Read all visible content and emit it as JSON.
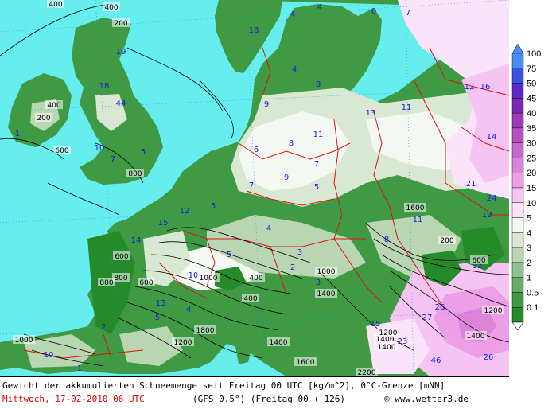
{
  "caption": {
    "description": "Gewicht der akkumulierten Schneemenge seit Freitag 00 UTC [kg/m^2], 0°C-Grenze [mNN]",
    "valid_time": "Mittwoch, 17-02-2010  06 UTC",
    "model_info": "(GFS 0.5°)  (Freitag 00 + 126)",
    "credit": "© www.wetter3.de"
  },
  "legend": {
    "levels": [
      "100",
      "75",
      "50",
      "45",
      "40",
      "35",
      "30",
      "25",
      "20",
      "15",
      "10",
      "5",
      "4",
      "3",
      "2",
      "1",
      "0.5",
      "0.1"
    ],
    "colors": [
      "#4a8cf0",
      "#3c50e0",
      "#5a28c8",
      "#7a28b4",
      "#9c3ab8",
      "#b450c0",
      "#c868cc",
      "#dc84d8",
      "#ec9ee6",
      "#f6c4f2",
      "#fbe4fa",
      "#f4f8f2",
      "#d8e8d2",
      "#b8d6b2",
      "#90c290",
      "#68ac6a",
      "#3c9a42",
      "#248a2a"
    ]
  },
  "map": {
    "sea_color": "#66eeee",
    "snow_labels": [
      {
        "text": "18"
      },
      {
        "text": "4"
      },
      {
        "text": "4"
      },
      {
        "text": "0"
      },
      {
        "text": "7"
      },
      {
        "text": "19"
      },
      {
        "text": "18"
      },
      {
        "text": "9"
      },
      {
        "text": "4"
      },
      {
        "text": "8"
      },
      {
        "text": "12"
      },
      {
        "text": "16"
      },
      {
        "text": "44"
      },
      {
        "text": "13"
      },
      {
        "text": "11"
      },
      {
        "text": "14"
      },
      {
        "text": "1"
      },
      {
        "text": "10"
      },
      {
        "text": "5"
      },
      {
        "text": "7"
      },
      {
        "text": "6"
      },
      {
        "text": "8"
      },
      {
        "text": "11"
      },
      {
        "text": "7"
      },
      {
        "text": "9"
      },
      {
        "text": "7"
      },
      {
        "text": "5"
      },
      {
        "text": "21"
      },
      {
        "text": "24"
      },
      {
        "text": "15"
      },
      {
        "text": "12"
      },
      {
        "text": "5"
      },
      {
        "text": "4"
      },
      {
        "text": "11"
      },
      {
        "text": "19"
      },
      {
        "text": "14"
      },
      {
        "text": "5"
      },
      {
        "text": "3"
      },
      {
        "text": "8"
      },
      {
        "text": "32"
      },
      {
        "text": "10"
      },
      {
        "text": "13"
      },
      {
        "text": "5"
      },
      {
        "text": "4"
      },
      {
        "text": "15"
      },
      {
        "text": "26"
      },
      {
        "text": "27"
      },
      {
        "text": "2"
      },
      {
        "text": "46"
      },
      {
        "text": "26"
      },
      {
        "text": "23"
      },
      {
        "text": "10"
      },
      {
        "text": "3"
      },
      {
        "text": "2"
      },
      {
        "text": "1"
      }
    ],
    "contour_labels": [
      {
        "text": "400"
      },
      {
        "text": "400"
      },
      {
        "text": "200"
      },
      {
        "text": "400"
      },
      {
        "text": "200"
      },
      {
        "text": "600"
      },
      {
        "text": "600"
      },
      {
        "text": "800"
      },
      {
        "text": "800"
      },
      {
        "text": "600"
      },
      {
        "text": "1000"
      },
      {
        "text": "1800"
      },
      {
        "text": "1200"
      },
      {
        "text": "1400"
      },
      {
        "text": "400"
      },
      {
        "text": "1000"
      },
      {
        "text": "1400"
      },
      {
        "text": "1400"
      },
      {
        "text": "1400"
      },
      {
        "text": "1600"
      },
      {
        "text": "2200"
      },
      {
        "text": "200"
      },
      {
        "text": "600"
      },
      {
        "text": "1000"
      },
      {
        "text": "800"
      },
      {
        "text": "1200"
      },
      {
        "text": "400"
      },
      {
        "text": "1600"
      },
      {
        "text": "1200"
      },
      {
        "text": "1400"
      }
    ]
  }
}
